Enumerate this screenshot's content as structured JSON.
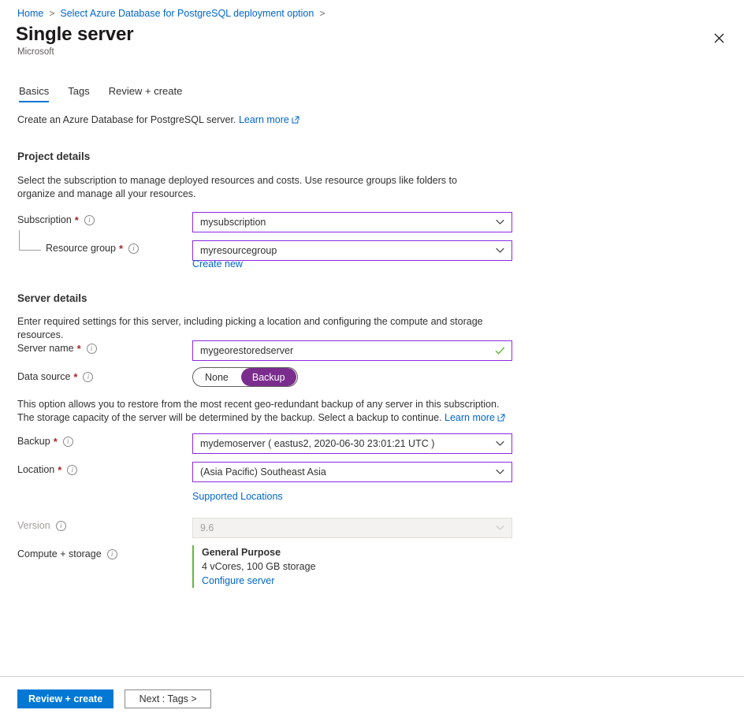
{
  "breadcrumb": {
    "items": [
      {
        "label": "Home"
      },
      {
        "label": "Select Azure Database for PostgreSQL deployment option"
      }
    ],
    "separator": ">"
  },
  "header": {
    "title": "Single server",
    "publisher": "Microsoft",
    "close_icon": "close-icon"
  },
  "tabs": [
    {
      "label": "Basics",
      "active": true
    },
    {
      "label": "Tags",
      "active": false
    },
    {
      "label": "Review + create",
      "active": false
    }
  ],
  "intro": {
    "text": "Create an Azure Database for PostgreSQL server.",
    "link_label": "Learn more"
  },
  "project_details": {
    "title": "Project details",
    "description": "Select the subscription to manage deployed resources and costs. Use resource groups like folders to organize and manage all your resources.",
    "subscription": {
      "label": "Subscription",
      "required": "*",
      "value": "mysubscription"
    },
    "resource_group": {
      "label": "Resource group",
      "required": "*",
      "value": "myresourcegroup",
      "create_new_label": "Create new"
    }
  },
  "server_details": {
    "title": "Server details",
    "description": "Enter required settings for this server, including picking a location and configuring the compute and storage resources.",
    "server_name": {
      "label": "Server name",
      "required": "*",
      "value": "mygeorestoredserver"
    },
    "data_source": {
      "label": "Data source",
      "required": "*",
      "options": [
        {
          "label": "None",
          "selected": false
        },
        {
          "label": "Backup",
          "selected": true
        }
      ]
    },
    "backup_note": {
      "text": "This option allows you to restore from the most recent geo-redundant backup of any server in this subscription. The storage capacity of the server will be determined by the backup. Select a backup to continue.",
      "link_label": "Learn more"
    },
    "backup": {
      "label": "Backup",
      "required": "*",
      "value": "mydemoserver ( eastus2, 2020-06-30 23:01:21 UTC )"
    },
    "location": {
      "label": "Location",
      "required": "*",
      "value": "(Asia Pacific) Southeast Asia",
      "supported_locations_label": "Supported Locations"
    },
    "version": {
      "label": "Version",
      "value": "9.6",
      "disabled": true
    },
    "compute_storage": {
      "label": "Compute + storage",
      "tier": "General Purpose",
      "specs": "4 vCores, 100 GB storage",
      "configure_label": "Configure server"
    }
  },
  "footer": {
    "primary_label": "Review + create",
    "secondary_label": "Next : Tags >"
  },
  "colors": {
    "accent_blue": "#0078d4",
    "link_blue": "#0066cc",
    "field_border_purple": "#8a2be2",
    "toggle_selected_purple": "#7b2d8e",
    "required_red": "#a4262c",
    "valid_green": "#5dba3a"
  }
}
